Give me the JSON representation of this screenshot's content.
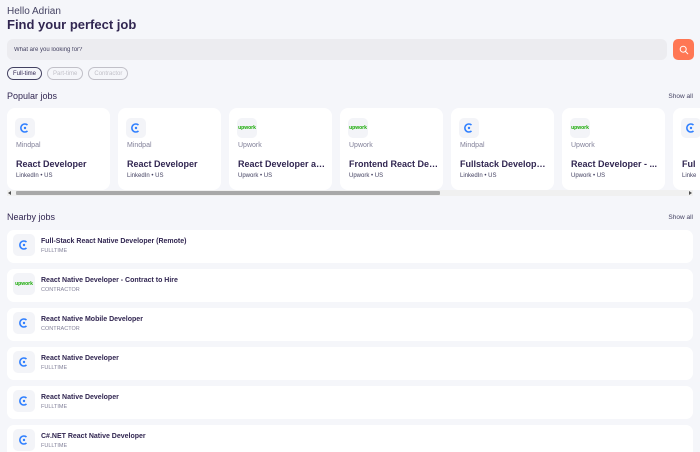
{
  "header": {
    "greeting": "Hello Adrian",
    "headline": "Find your perfect job"
  },
  "search": {
    "placeholder": "What are you looking for?",
    "value": "",
    "button_icon": "search-icon"
  },
  "job_type_tabs": [
    {
      "label": "Full-time",
      "active": true
    },
    {
      "label": "Part-time",
      "active": false
    },
    {
      "label": "Contractor",
      "active": false
    }
  ],
  "popular": {
    "title": "Popular jobs",
    "show_all": "Show all",
    "cards": [
      {
        "company": "Mindpal",
        "logo": "mindpal-logo",
        "title": "React Developer",
        "meta": "LinkedIn • US"
      },
      {
        "company": "Mindpal",
        "logo": "mindpal-logo",
        "title": "React Developer",
        "meta": "LinkedIn • US"
      },
      {
        "company": "Upwork",
        "logo": "upwork-logo",
        "title": "React Developer an...",
        "meta": "Upwork • US"
      },
      {
        "company": "Upwork",
        "logo": "upwork-logo",
        "title": "Frontend React Dev...",
        "meta": "Upwork • US"
      },
      {
        "company": "Mindpal",
        "logo": "mindpal-logo",
        "title": "Fullstack Developer...",
        "meta": "LinkedIn • US"
      },
      {
        "company": "Upwork",
        "logo": "upwork-logo",
        "title": "React Developer - ...",
        "meta": "Upwork • US"
      },
      {
        "company": "",
        "logo": "mindpal-logo",
        "title": "Ful",
        "meta": "Linke"
      }
    ]
  },
  "nearby": {
    "title": "Nearby jobs",
    "show_all": "Show all",
    "items": [
      {
        "title": "Full-Stack React Native Developer (Remote)",
        "type": "FULLTIME",
        "logo": "mindpal-logo"
      },
      {
        "title": "React Native Developer - Contract to Hire",
        "type": "CONTRACTOR",
        "logo": "upwork-logo"
      },
      {
        "title": "React Native Mobile Developer",
        "type": "CONTRACTOR",
        "logo": "mindpal-logo"
      },
      {
        "title": "React Native Developer",
        "type": "FULLTIME",
        "logo": "mindpal-logo"
      },
      {
        "title": "React Native Developer",
        "type": "FULLTIME",
        "logo": "mindpal-logo"
      },
      {
        "title": "C#.NET React Native Developer",
        "type": "FULLTIME",
        "logo": "mindpal-logo"
      }
    ]
  },
  "brand_text": {
    "upwork": "upwork"
  },
  "colors": {
    "accent": "#ff7754",
    "primary": "#312651",
    "upwork_green": "#14a800",
    "mindpal_blue": "#2f7fff"
  }
}
